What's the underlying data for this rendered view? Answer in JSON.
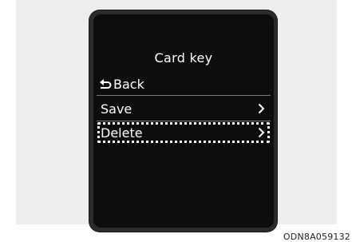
{
  "screen": {
    "title": "Card key",
    "back_label": "Back",
    "items": [
      {
        "label": "Save",
        "selected": false
      },
      {
        "label": "Delete",
        "selected": true
      }
    ]
  },
  "figure_code": "ODN8A059132",
  "colors": {
    "screen_background": "#0d0d0d",
    "bezel": "#2b2b2b",
    "text": "#ffffff",
    "selection_outline": "#ffffff"
  },
  "icons": {
    "back": "back-arrow-icon",
    "chevron": "chevron-right-icon"
  }
}
